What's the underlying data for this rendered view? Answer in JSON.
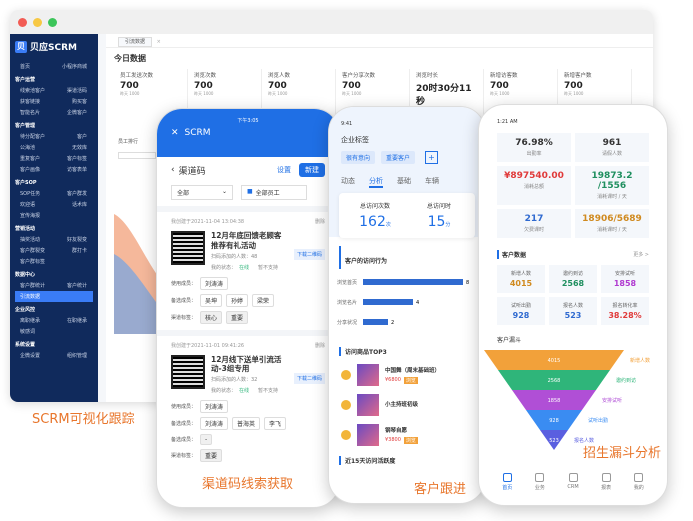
{
  "desktop": {
    "brand": "贝应SCRM",
    "brand_logo": "贝",
    "tab": "引流数据",
    "today_title": "今日数据",
    "sidebar": [
      {
        "type": "row",
        "left": "首页",
        "right": "小程序商城"
      },
      {
        "type": "sec",
        "label": "客户运营"
      },
      {
        "type": "row",
        "left": "线索池客户",
        "right": "渠道活码"
      },
      {
        "type": "row",
        "left": "获客链接",
        "right": "购买客"
      },
      {
        "type": "row",
        "left": "智能名片",
        "right": "企微客户"
      },
      {
        "type": "sec",
        "label": "客户管理"
      },
      {
        "type": "row",
        "left": "待分配客户",
        "right": "客户"
      },
      {
        "type": "row",
        "left": "公海池",
        "right": "无效库"
      },
      {
        "type": "row",
        "left": "重复客户",
        "right": "客户标签"
      },
      {
        "type": "row",
        "left": "客户画像",
        "right": "访客表单"
      },
      {
        "type": "sec",
        "label": "客户SOP"
      },
      {
        "type": "row",
        "left": "SOP任务",
        "right": "客户群发"
      },
      {
        "type": "row",
        "left": "欢迎语",
        "right": "话术库"
      },
      {
        "type": "row",
        "left": "宣传海报",
        "right": ""
      },
      {
        "type": "sec",
        "label": "营销活动"
      },
      {
        "type": "row",
        "left": "抽奖活动",
        "right": "好友裂变"
      },
      {
        "type": "row",
        "left": "客户群裂变",
        "right": "群打卡"
      },
      {
        "type": "row",
        "left": "客户群标签",
        "right": ""
      },
      {
        "type": "sec",
        "label": "数据中心"
      },
      {
        "type": "row",
        "left": "客户群统计",
        "right": "客户统计"
      },
      {
        "type": "row",
        "active": true,
        "left": "引流数据",
        "right": ""
      },
      {
        "type": "sec",
        "label": "企业风控"
      },
      {
        "type": "row",
        "left": "离职继承",
        "right": "在职继承"
      },
      {
        "type": "row",
        "left": "敏感词",
        "right": ""
      },
      {
        "type": "sec",
        "label": "系统设置"
      },
      {
        "type": "row",
        "left": "企微设置",
        "right": "组织管理"
      }
    ],
    "stats": [
      {
        "label": "员工发送次数",
        "value": "700",
        "sub": "昨天 1000"
      },
      {
        "label": "浏览次数",
        "value": "700",
        "sub": "昨天 1000"
      },
      {
        "label": "浏览人数",
        "value": "700",
        "sub": "昨天 1000"
      },
      {
        "label": "客户分享次数",
        "value": "700",
        "sub": "昨天 1000"
      },
      {
        "label": "浏览时长",
        "value": "20时30分11秒",
        "sub": "昨天 1000"
      },
      {
        "label": "新增访客数",
        "value": "700",
        "sub": "昨天 1000"
      },
      {
        "label": "新增客户数",
        "value": "700",
        "sub": "昨天 1000"
      }
    ],
    "rank_label": "员工排行",
    "caption": "SCRM可视化跟踪"
  },
  "phone1": {
    "time": "下午3:05",
    "header": "SCRM",
    "page_title": "渠道码",
    "settings": "设置",
    "new_btn": "新建",
    "filter_all": "全部",
    "filter_staff": "全部员工",
    "cards": [
      {
        "created": "我创建于2021-11-04 13:04:38",
        "delete": "删除",
        "title": "12月年底回馈老顾客推荐有礼活动",
        "added": "扫码添加的人数：48",
        "status_label": "我的状态：",
        "status": "在线",
        "note": "暂不支持",
        "user_label": "使用成员：",
        "user": "刘涛涛",
        "backup_label": "备选成员：",
        "backups": [
          "吴坤",
          "孙婷",
          "梁荣"
        ],
        "tag_label": "渠道标签：",
        "tags": [
          "核心",
          "重要"
        ],
        "download": "下载二维码"
      },
      {
        "created": "我创建于2021-11-01 09:41:26",
        "delete": "删除",
        "title": "12月线下送单引流活动-3组专用",
        "added": "扫码添加的人数：32",
        "status_label": "我的状态：",
        "status": "在线",
        "note": "暂不支持",
        "user_label": "使用成员：",
        "user": "刘涛涛",
        "backup_label": "备选成员：",
        "backups": [
          "刘涛涛",
          "普海英",
          "李飞"
        ],
        "tag_label": "备选成员：",
        "tags": [
          "-"
        ],
        "tag_label2": "渠道标签：",
        "tags2": [
          "重要"
        ],
        "download": "下载二维码"
      }
    ],
    "caption": "渠道码线索获取"
  },
  "phone2": {
    "time": "9:41",
    "title": "企业标签",
    "tag_chips": [
      "很有意向",
      "重要客户"
    ],
    "tabs": [
      "动态",
      "分析",
      "基础",
      "车辆"
    ],
    "active_tab": "分析",
    "visit_count_label": "总访问次数",
    "visit_count": "162",
    "visit_count_unit": "次",
    "visit_time_label": "总访问时",
    "visit_time": "15",
    "visit_time_unit": "分",
    "behavior_title": "客户的访问行为",
    "caption": "客户跟进",
    "top3_title": "访问商品TOP3",
    "products": [
      {
        "name": "中国舞（周末基础班）",
        "price": "¥6800",
        "badge": "浏览"
      },
      {
        "name": "小主持班初级",
        "price": "",
        "badge": ""
      },
      {
        "name": "钢琴自愿",
        "price": "¥3800",
        "badge": "浏览"
      }
    ],
    "recent_title": "近15天访问活跃度"
  },
  "phone3": {
    "time": "1:21 AM",
    "cards": [
      {
        "value": "76.98%",
        "label": "出勤率",
        "color": "#333"
      },
      {
        "value": "961",
        "label": "请假人数",
        "color": "#333"
      },
      {
        "value": "¥897540.00",
        "label": "消耗总额",
        "color": "#e03a3a"
      },
      {
        "value": "19873.2 /1556",
        "label": "消耗课时 / 天",
        "color": "#1f8f5f"
      },
      {
        "value": "217",
        "label": "欠费课时",
        "color": "#2f6ad0"
      },
      {
        "value": "18906/5689",
        "label": "消耗课时 / 天",
        "color": "#d08a1f"
      }
    ],
    "cust_title": "客户数据",
    "more": "更多 >",
    "cust_cells": [
      {
        "label": "新增人数",
        "value": "4015",
        "color": "#d08a1f"
      },
      {
        "label": "邀约到访",
        "value": "2568",
        "color": "#1f8f5f"
      },
      {
        "label": "安排试听",
        "value": "1858",
        "color": "#b03ad0"
      },
      {
        "label": "试听出勤",
        "value": "928",
        "color": "#2f6ad0"
      },
      {
        "label": "报名人数",
        "value": "523",
        "color": "#2f6ad0"
      },
      {
        "label": "报名转化率",
        "value": "38.28%",
        "color": "#e03a3a"
      }
    ],
    "funnel_title": "客户漏斗",
    "funnel": [
      {
        "value": "4015",
        "label": "新增人数",
        "color": "#f2a13a"
      },
      {
        "value": "2568",
        "label": "邀约到访",
        "color": "#2fb57a"
      },
      {
        "value": "1858",
        "label": "安排试听",
        "color": "#b04fd6"
      },
      {
        "value": "928",
        "label": "试听出勤",
        "color": "#3a8cf2"
      },
      {
        "value": "523",
        "label": "报名人数",
        "color": "#5a5fe0"
      }
    ],
    "nav": [
      "首页",
      "业务",
      "CRM",
      "报表",
      "我的"
    ],
    "caption": "招生漏斗分析"
  }
}
